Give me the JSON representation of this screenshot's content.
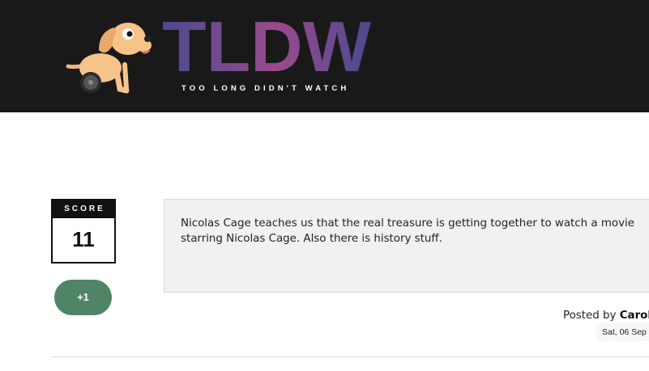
{
  "header": {
    "logo_text": "TLDW",
    "tagline": "TOO LONG  DIDN'T WATCH",
    "background_color": "#1a191a",
    "logo_gradient": [
      "#4b4a8f",
      "#8a4a8a",
      "#4b4a8f"
    ]
  },
  "post": {
    "score_label": "SCORE",
    "score_value": "11",
    "vote_label": "+1",
    "vote_color": "#4f8466",
    "summary": "Nicolas Cage teaches us that the real treasure is getting together to watch a movie starring Nicolas Cage. Also there is history stuff.",
    "posted_by_prefix": "Posted by",
    "author": "Carol",
    "date": "Sat, 06 Sep"
  },
  "icons": {
    "logo_mascot": "dog-on-wheel-icon"
  }
}
